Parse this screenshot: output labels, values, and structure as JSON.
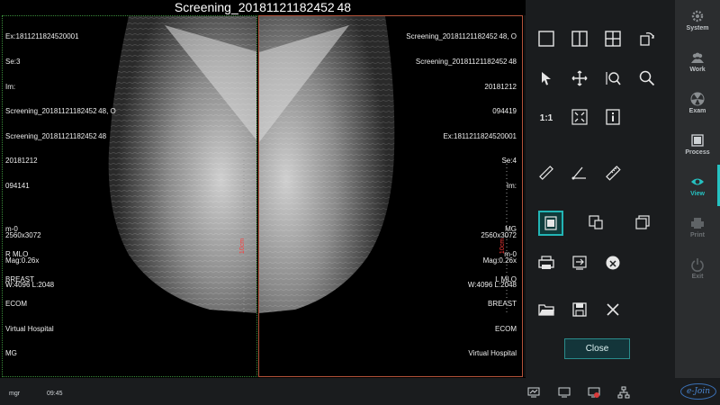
{
  "title": "Screening_20181121182452 48",
  "left_view": {
    "top_left": [
      "Ex:1811211824520001",
      "Se:3",
      "Im:",
      "Screening_20181121182452 48, O",
      "Screening_20181121182452 48",
      "20181212",
      "094141",
      "",
      "2560x3072",
      "Mag:0.26x",
      "W:4096 L:2048"
    ],
    "bottom_left": [
      "m-0",
      "R MLO",
      "BREAST",
      "ECOM",
      "Virtual Hospital",
      "MG"
    ],
    "ruler_label": "10cm"
  },
  "right_view": {
    "top_right": [
      "Screening_20181121182452 48, O",
      "Screening_20181121182452 48",
      "20181212",
      "094419",
      "Ex:1811211824520001",
      "Se:4",
      "Im:",
      "",
      "2560x3072",
      "Mag:0.26x",
      "W:4096 L:2048"
    ],
    "bottom_right": [
      "MG",
      "m-0",
      "L MLO",
      "BREAST",
      "ECOM",
      "Virtual Hospital"
    ],
    "ruler_label": "10cm"
  },
  "tools": {
    "close_label": "Close",
    "icons": [
      "layout-1x1-icon",
      "layout-1x2-icon",
      "layout-2x2-icon",
      "swap-icon",
      "pointer-icon",
      "pan-icon",
      "zoom-region-icon",
      "magnifier-icon",
      "actual-size-icon",
      "fit-icon",
      "info-icon",
      "ruler-icon",
      "angle-icon",
      "calibrate-icon",
      "view-mode-icon",
      "compare-icon",
      "stack-icon",
      "print-icon",
      "export-icon",
      "burn-icon",
      "open-folder-icon",
      "save-icon",
      "close-x-icon"
    ]
  },
  "nav": {
    "items": [
      {
        "label": "System",
        "icon": "gear-icon",
        "state": "normal"
      },
      {
        "label": "Work",
        "icon": "users-icon",
        "state": "normal"
      },
      {
        "label": "Exam",
        "icon": "radiation-icon",
        "state": "normal"
      },
      {
        "label": "Process",
        "icon": "process-icon",
        "state": "normal"
      },
      {
        "label": "View",
        "icon": "eye-icon",
        "state": "active"
      },
      {
        "label": "Print",
        "icon": "printer-icon",
        "state": "disabled"
      },
      {
        "label": "Exit",
        "icon": "power-icon",
        "state": "disabled"
      }
    ],
    "accent_color": "#25c2c2"
  },
  "status": {
    "user": "mgr",
    "time": "09:45",
    "brand": "e-Join"
  }
}
